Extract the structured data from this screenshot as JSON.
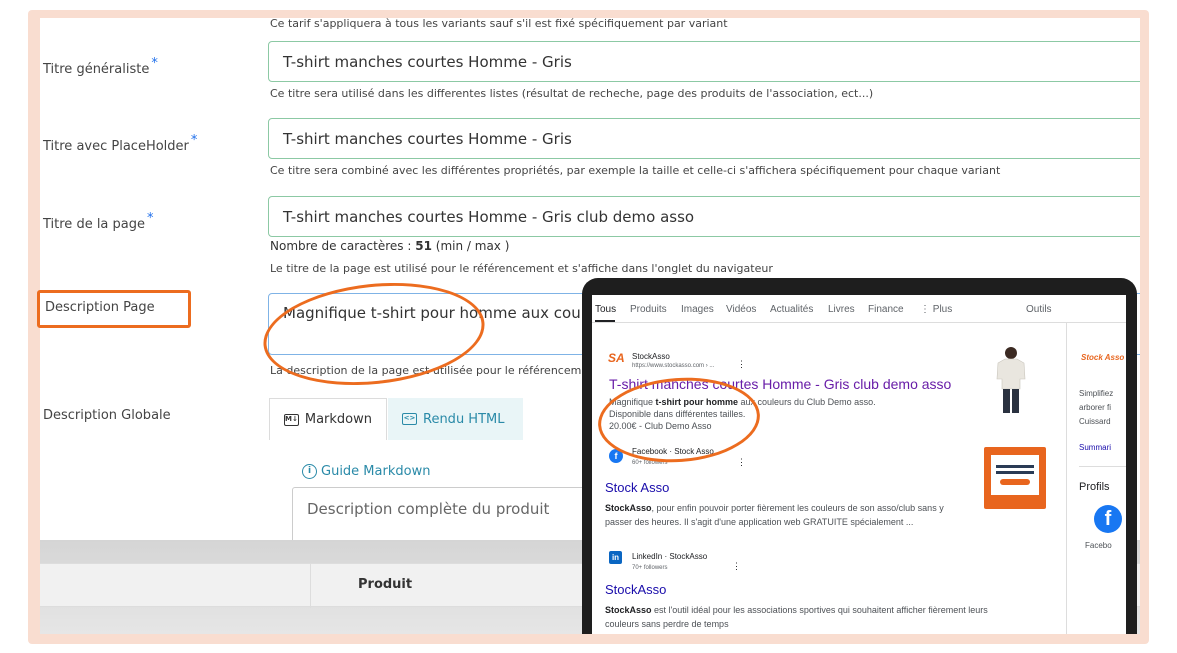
{
  "form": {
    "top_hint": "Ce tarif s'appliquera à tous les variants sauf s'il est fixé spécifiquement par variant",
    "fields": [
      {
        "label": "Titre généraliste",
        "value": "T-shirt manches courtes Homme - Gris",
        "hint": "Ce titre sera utilisé dans les differentes listes (résultat de recheche, page des produits de l'association, ect...)"
      },
      {
        "label": "Titre avec PlaceHolder",
        "value": "T-shirt manches courtes Homme - Gris",
        "hint": "Ce titre sera combiné avec les différentes propriétés, par exemple la taille et celle-ci s'affichera spécifiquement pour chaque variant"
      },
      {
        "label": "Titre de la page",
        "value": "T-shirt manches courtes Homme - Gris club demo asso",
        "counter_prefix": "Nombre de caractères :",
        "counter_value": "51",
        "counter_suffix": "(min / max )",
        "hint": "Le titre de la page est utilisé pour le référencement et s'affiche dans l'onglet du navigateur"
      },
      {
        "label": "Description Page",
        "value": "Magnifique t-shirt pour homme aux couleurs",
        "hint": "La description de la page est utilisée pour le référencement"
      }
    ],
    "required_mark": "*",
    "global": {
      "label": "Description Globale",
      "tab_markdown": "Markdown",
      "tab_html": "Rendu HTML",
      "guide_link": "Guide Markdown",
      "placeholder": "Description complète du produit"
    },
    "table": {
      "column_product": "Produit"
    }
  },
  "serp": {
    "tabs": [
      "Tous",
      "Produits",
      "Images",
      "Vidéos",
      "Actualités",
      "Livres",
      "Finance",
      "⋮ Plus"
    ],
    "tools": "Outils",
    "results": [
      {
        "site": "StockAsso",
        "url": "https://www.stockasso.com › ...",
        "title": "T-shirt manches courtes Homme - Gris club demo asso",
        "snippet_pre": "Magnifique ",
        "snippet_bold": "t-shirt pour homme",
        "snippet_post": " aux couleurs du Club Demo asso.",
        "line2": "Disponible dans différentes tailles.",
        "line3": "20.00€ - Club Demo Asso"
      },
      {
        "site": "Facebook · Stock Asso",
        "followers": "60+ followers",
        "title": "Stock Asso",
        "bold": "StockAsso",
        "text1": ", pour enfin pouvoir porter fièrement les couleurs de son asso/club sans y",
        "text2": "passer des heures. Il s'agit d'une application web GRATUITE spécialement ..."
      },
      {
        "site": "LinkedIn · StockAsso",
        "followers": "70+ followers",
        "title": "StockAsso",
        "bold": "StockAsso",
        "text1": " est l'outil idéal pour les associations sportives qui souhaitent afficher fièrement leurs",
        "text2": "couleurs sans perdre de temps"
      }
    ],
    "side": {
      "brand": "Stock Asso",
      "line1": "Simplifiez",
      "line2": "arborer fi",
      "line3": "Cuissard",
      "summary": "Summari",
      "profiles": "Profils",
      "fb": "Facebo"
    },
    "dots": "⋮"
  },
  "colors": {
    "highlight": "#ec6c1f",
    "link": "#1a0dab",
    "input_border": "#8cc9a4"
  }
}
